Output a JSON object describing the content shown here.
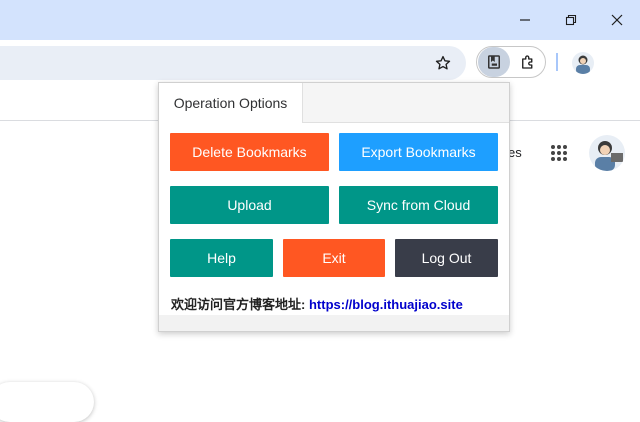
{
  "window_controls": {
    "minimize_icon": "minimize-icon",
    "restore_icon": "restore-icon",
    "close_icon": "close-icon"
  },
  "toolbar": {
    "bookmark_icon": "star-icon",
    "extension_icon": "bookmark-extension-icon",
    "extensions_menu_icon": "puzzle-icon",
    "profile_icon": "avatar"
  },
  "page": {
    "partial_text": "es",
    "apps_icon": "apps-grid-icon"
  },
  "popup": {
    "tabs": [
      {
        "label": "Operation Options"
      }
    ],
    "buttons": {
      "delete": "Delete Bookmarks",
      "export": "Export Bookmarks",
      "upload": "Upload",
      "sync": "Sync from Cloud",
      "help": "Help",
      "exit": "Exit",
      "logout": "Log Out"
    },
    "footer_label": "欢迎访问官方博客地址:",
    "footer_link": "https://blog.ithuajiao.site"
  },
  "colors": {
    "titlebar": "#d3e3fd",
    "red": "#ff5722",
    "blue": "#1e9fff",
    "teal": "#009688",
    "dark": "#393d49",
    "link": "#0000cc"
  }
}
